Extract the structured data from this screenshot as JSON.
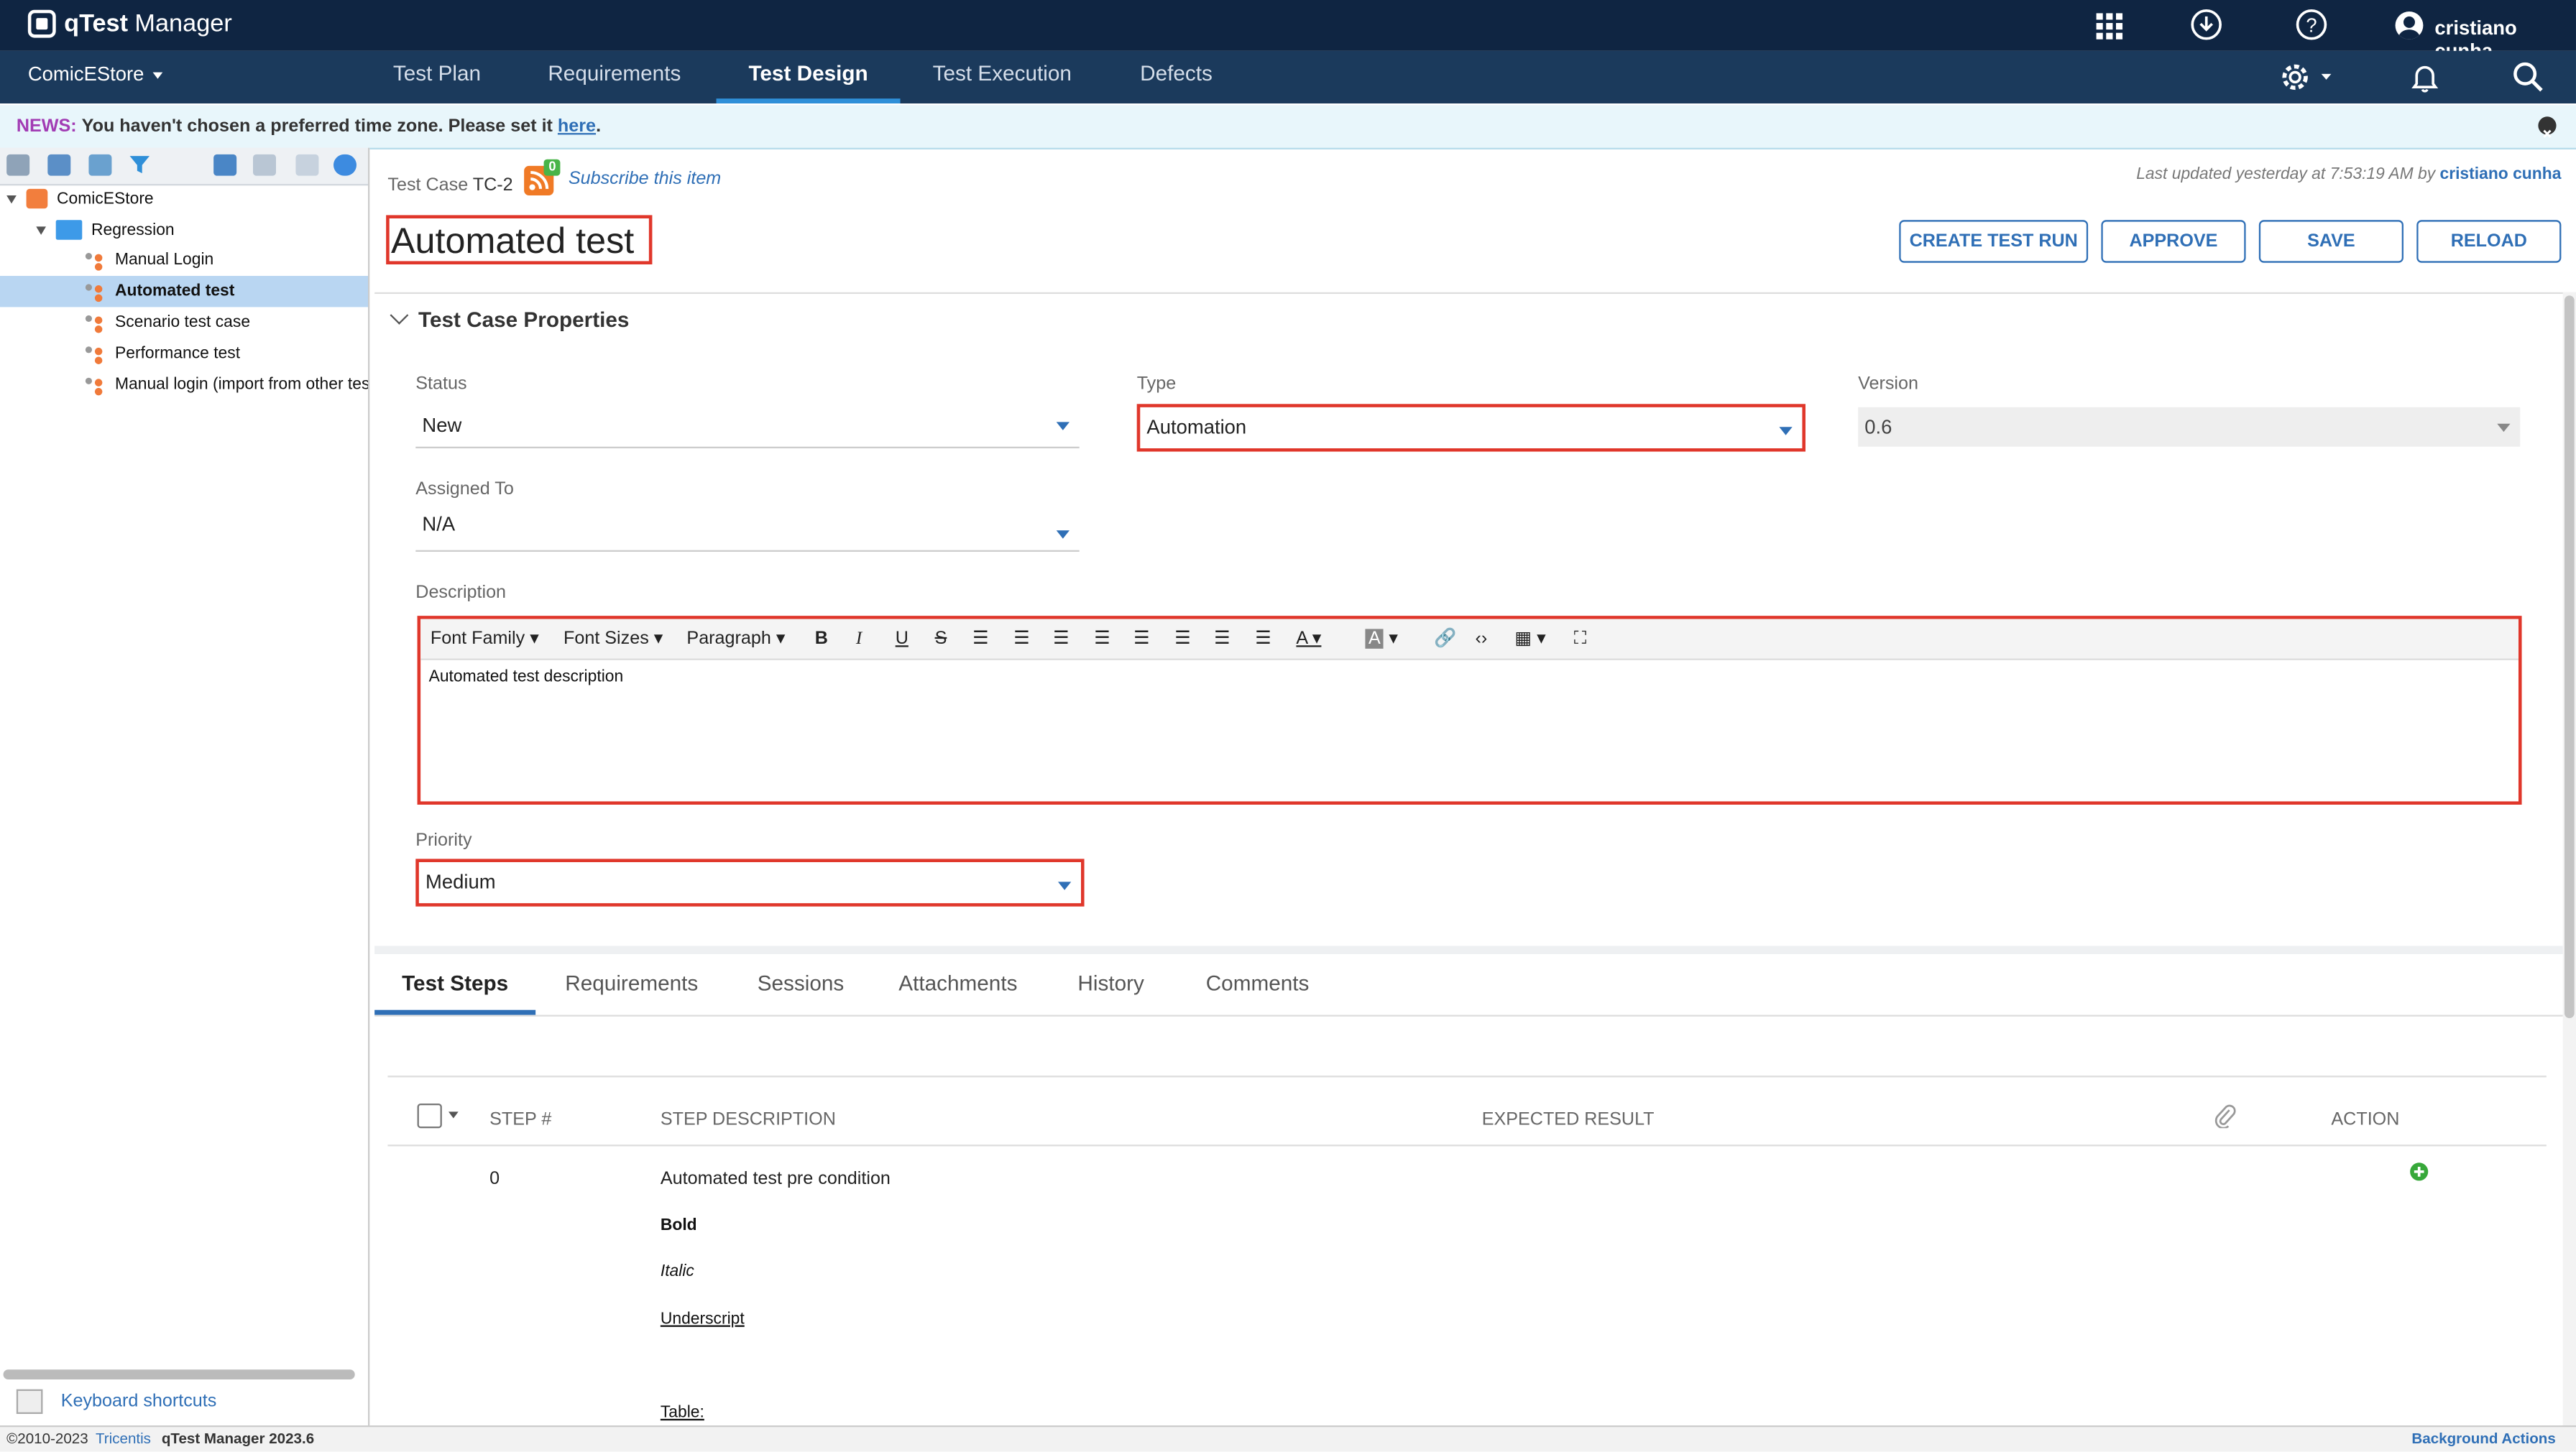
{
  "topbar": {
    "logo_text": "qTest",
    "app_name": "Manager",
    "user_name": "cristiano cunha"
  },
  "nav": {
    "project": "ComicEStore",
    "tabs": [
      "Test Plan",
      "Requirements",
      "Test Design",
      "Test Execution",
      "Defects"
    ],
    "active_tab": "Test Design"
  },
  "news": {
    "label": "NEWS:",
    "text": "You haven't chosen a preferred time zone. Please set it",
    "link": "here",
    "end": "."
  },
  "tree": {
    "root": "ComicEStore",
    "folder": "Regression",
    "items": [
      "Manual Login",
      "Automated test",
      "Scenario test case",
      "Performance test",
      "Manual login (import from other test"
    ],
    "selected": "Automated test"
  },
  "sidebar_footer": {
    "shortcuts": "Keyboard shortcuts"
  },
  "testcase": {
    "label": "Test Case",
    "id": "TC-2",
    "subscribe_count": "0",
    "subscribe": "Subscribe this item",
    "last_updated": "Last updated yesterday at 7:53:19 AM by",
    "updated_by": "cristiano cunha",
    "title": "Automated test"
  },
  "buttons": {
    "create_test_run": "CREATE TEST RUN",
    "approve": "APPROVE",
    "save": "SAVE",
    "reload": "RELOAD"
  },
  "properties": {
    "heading": "Test Case Properties",
    "status_label": "Status",
    "status": "New",
    "type_label": "Type",
    "type": "Automation",
    "version_label": "Version",
    "version": "0.6",
    "assigned_label": "Assigned To",
    "assigned": "N/A",
    "description_label": "Description",
    "description": "Automated test description",
    "priority_label": "Priority",
    "priority": "Medium"
  },
  "editor": {
    "font_family": "Font Family",
    "font_sizes": "Font Sizes",
    "paragraph": "Paragraph"
  },
  "lower_tabs": [
    "Test Steps",
    "Requirements",
    "Sessions",
    "Attachments",
    "History",
    "Comments"
  ],
  "steps": {
    "columns": {
      "step": "STEP #",
      "description": "STEP DESCRIPTION",
      "expected": "EXPECTED RESULT",
      "action": "ACTION"
    },
    "rows": [
      {
        "step": "0",
        "description": "Automated test pre condition",
        "bold": "Bold",
        "italic": "Italic",
        "underline": "Underscript",
        "table": "Table:"
      }
    ]
  },
  "footer": {
    "copyright": "©2010-2023",
    "company": "Tricentis",
    "version": "qTest Manager 2023.6",
    "background": "Background Actions"
  },
  "colors": {
    "topbar": "#0f2542",
    "navbar": "#1b3a5c",
    "accent": "#2f6fb6",
    "highlight": "#e0372b"
  }
}
